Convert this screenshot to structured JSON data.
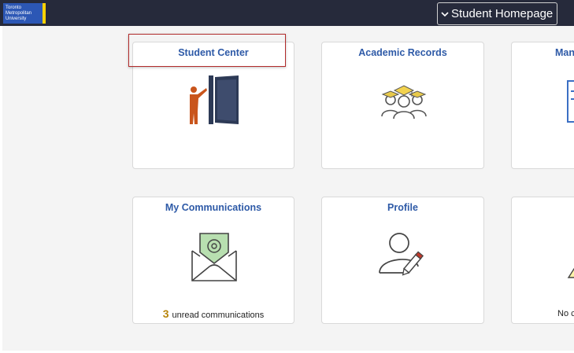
{
  "header": {
    "logo_lines": [
      "Toronto",
      "Metropolitan",
      "University"
    ],
    "homepage_label": "Student Homepage"
  },
  "tiles": [
    {
      "title": "Student Center",
      "icon": "teacher-door-icon"
    },
    {
      "title": "Academic Records",
      "icon": "graduates-icon"
    },
    {
      "title": "Man",
      "icon": "document-icon"
    },
    {
      "title": "My Communications",
      "icon": "envelope-at-icon",
      "unread_count": "3",
      "unread_label": "unread communications"
    },
    {
      "title": "Profile",
      "icon": "user-edit-icon"
    },
    {
      "title": "",
      "icon": "warning-icon",
      "footer_text": "No c"
    }
  ],
  "colors": {
    "topbar": "#262a3b",
    "title_blue": "#2e5aa7",
    "focus_red": "#b22b2b",
    "accent_yellow": "#ffd200",
    "logo_blue": "#2c57b5"
  }
}
